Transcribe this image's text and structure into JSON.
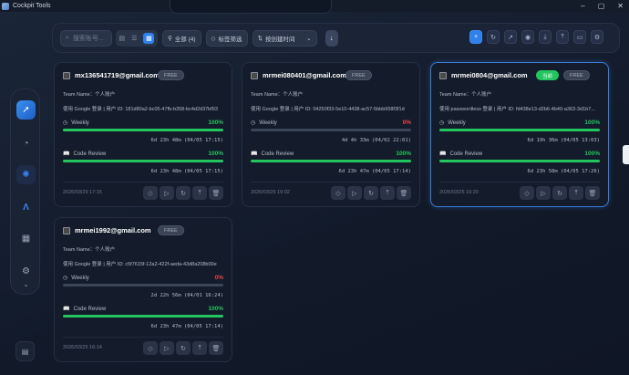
{
  "window": {
    "title": "Cockpit Tools",
    "min": "–",
    "max": "▢",
    "close": "✕"
  },
  "toolbar": {
    "search_placeholder": "搜索账号...",
    "filter_all": "全部 (4)",
    "tag_filter": "标签筛选",
    "sort": "按创建时间",
    "icons": [
      "add-icon",
      "refresh-icon",
      "external-link-icon",
      "eye-icon",
      "import-icon",
      "export-icon",
      "folder-icon",
      "settings-icon"
    ]
  },
  "cards": [
    {
      "email": "mx136541719@gmail.com",
      "current": false,
      "current_label": "",
      "plan": "FREE",
      "team": "Team Name：个人账户",
      "uid": "使用 Google 登录 | 用户 ID: 181d80a2-bc05-47fb-b358-bc4d2d37bf93",
      "quotas": [
        {
          "label": "Weekly",
          "pct": "100%",
          "value": 100,
          "reset": "6d 23h 48m (04/05 17:15)"
        },
        {
          "label": "Code Review",
          "pct": "100%",
          "value": 100,
          "reset": "6d 23h 48m (04/05 17:15)"
        }
      ],
      "created": "2026/03/29 17:15"
    },
    {
      "email": "mrmei080401@gmail.com",
      "current": false,
      "current_label": "",
      "plan": "FREE",
      "team": "Team Name：个人账户",
      "uid": "使用 Google 登录 | 用户 ID: 04250f33-5e10-4438-ac57-5bbb958f3f1d",
      "quotas": [
        {
          "label": "Weekly",
          "pct": "0%",
          "value": 0,
          "reset": "4d 4h 33m (04/02 22:01)"
        },
        {
          "label": "Code Review",
          "pct": "100%",
          "value": 100,
          "reset": "6d 23h 47m (04/05 17:14)"
        }
      ],
      "created": "2026/03/26 19:02"
    },
    {
      "email": "mrmei0804@gmail.com",
      "current": true,
      "current_label": "当前",
      "plan": "FREE",
      "team": "Team Name：个人账户",
      "uid": "使用 passwordless 登录 | 用户 ID: fd438e13-d2b6-4b40-a363-3d1b7...",
      "quotas": [
        {
          "label": "Weekly",
          "pct": "100%",
          "value": 100,
          "reset": "6d 19h 36m (04/05 13:03)"
        },
        {
          "label": "Code Review",
          "pct": "100%",
          "value": 100,
          "reset": "6d 23h 58m (04/05 17:26)"
        }
      ],
      "created": "2026/03/25 16:20"
    },
    {
      "email": "mrmei1992@gmail.com",
      "current": false,
      "current_label": "",
      "plan": "FREE",
      "team": "Team Name：个人账户",
      "uid": "使用 Google 登录 | 用户 ID: c5f7615f-12a2-422f-aeda-43d8a208b00e",
      "quotas": [
        {
          "label": "Weekly",
          "pct": "0%",
          "value": 0,
          "reset": "2d 22h 56m (04/01 16:24)"
        },
        {
          "label": "Code Review",
          "pct": "100%",
          "value": 100,
          "reset": "6d 23h 47m (04/05 17:14)"
        }
      ],
      "created": "2026/03/25 16:14"
    }
  ],
  "colors": {
    "accent": "#2f80ed",
    "good": "#22c55e",
    "bad": "#ef4444"
  },
  "sidebar": {
    "items": [
      "rocket-icon",
      "gauge-icon",
      "codex-icon",
      "antigravity-icon",
      "apps-icon",
      "settings-icon"
    ],
    "expand": "⌄"
  }
}
